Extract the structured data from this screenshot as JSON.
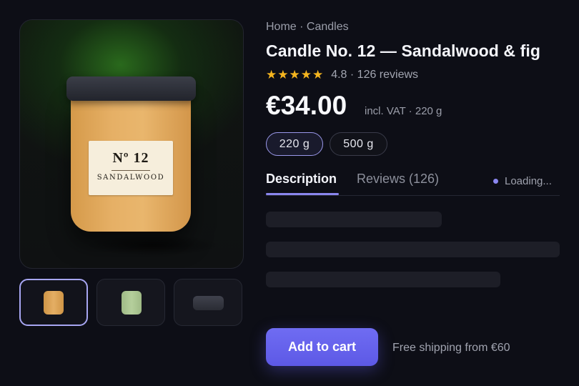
{
  "product_image": {
    "label_number": "Nº 12",
    "label_name": "SANDALWOOD"
  },
  "thumbnails": [
    {
      "name": "amber jar",
      "color": "#d99e4e",
      "active": true
    },
    {
      "name": "sage jar",
      "color": "#a9c48e",
      "active": false
    },
    {
      "name": "dark lid",
      "color": "#3a3c46",
      "active": false
    }
  ],
  "breadcrumb": "Home · Candles",
  "title": "Candle No. 12 — Sandalwood & fig",
  "rating": {
    "stars": "★★★★★",
    "score": 4.8,
    "text": "4.8 · 126 reviews"
  },
  "price": {
    "amount": "€34.00",
    "note": "incl. VAT · 220 g"
  },
  "sizes": [
    {
      "label": "220 g",
      "selected": true
    },
    {
      "label": "500 g",
      "selected": false
    }
  ],
  "tabs": [
    {
      "label": "Description",
      "active": true
    },
    {
      "label": "Reviews (126)",
      "active": false
    }
  ],
  "status": {
    "text": "Loading..."
  },
  "cta": {
    "add_to_cart": "Add to cart",
    "shipping_note": "Free shipping from €60"
  },
  "colors": {
    "accent": "#6865ee",
    "star": "#f5b51f",
    "background": "#0d0e16"
  }
}
